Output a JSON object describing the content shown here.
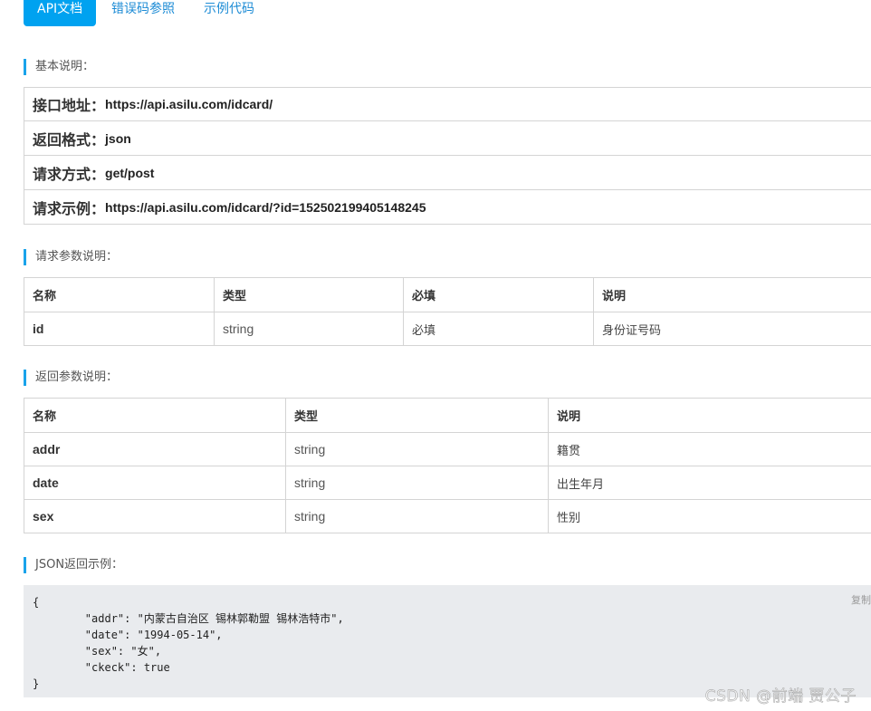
{
  "tabs": [
    {
      "label": "API文档",
      "active": true
    },
    {
      "label": "错误码参照",
      "active": false
    },
    {
      "label": "示例代码",
      "active": false
    }
  ],
  "basic": {
    "title": "基本说明：",
    "rows": [
      {
        "key": "接口地址：",
        "value": "https://api.asilu.com/idcard/"
      },
      {
        "key": "返回格式：",
        "value": "json"
      },
      {
        "key": "请求方式：",
        "value": "get/post"
      },
      {
        "key": "请求示例：",
        "value": "https://api.asilu.com/idcard/?id=152502199405148245"
      }
    ]
  },
  "request_params": {
    "title": "请求参数说明：",
    "headers": [
      "名称",
      "类型",
      "必填",
      "说明"
    ],
    "rows": [
      [
        "id",
        "string",
        "必填",
        "身份证号码"
      ]
    ]
  },
  "response_params": {
    "title": "返回参数说明：",
    "headers": [
      "名称",
      "类型",
      "说明"
    ],
    "rows": [
      [
        "addr",
        "string",
        "籍贯"
      ],
      [
        "date",
        "string",
        "出生年月"
      ],
      [
        "sex",
        "string",
        "性别"
      ]
    ]
  },
  "json_example": {
    "title": "JSON返回示例：",
    "copy_label": "复制",
    "lines": [
      "{",
      "        \"addr\": \"内蒙古自治区 锡林郭勒盟 锡林浩特市\",",
      "        \"date\": \"1994-05-14\",",
      "        \"sex\": \"女\",",
      "        \"ckeck\": true",
      "}"
    ]
  },
  "watermark": "CSDN @前端 贾公子",
  "colors": {
    "accent": "#00a2f0",
    "link": "#1c8bd5",
    "border": "#d4d4d4",
    "code_bg": "#e9ebee"
  }
}
